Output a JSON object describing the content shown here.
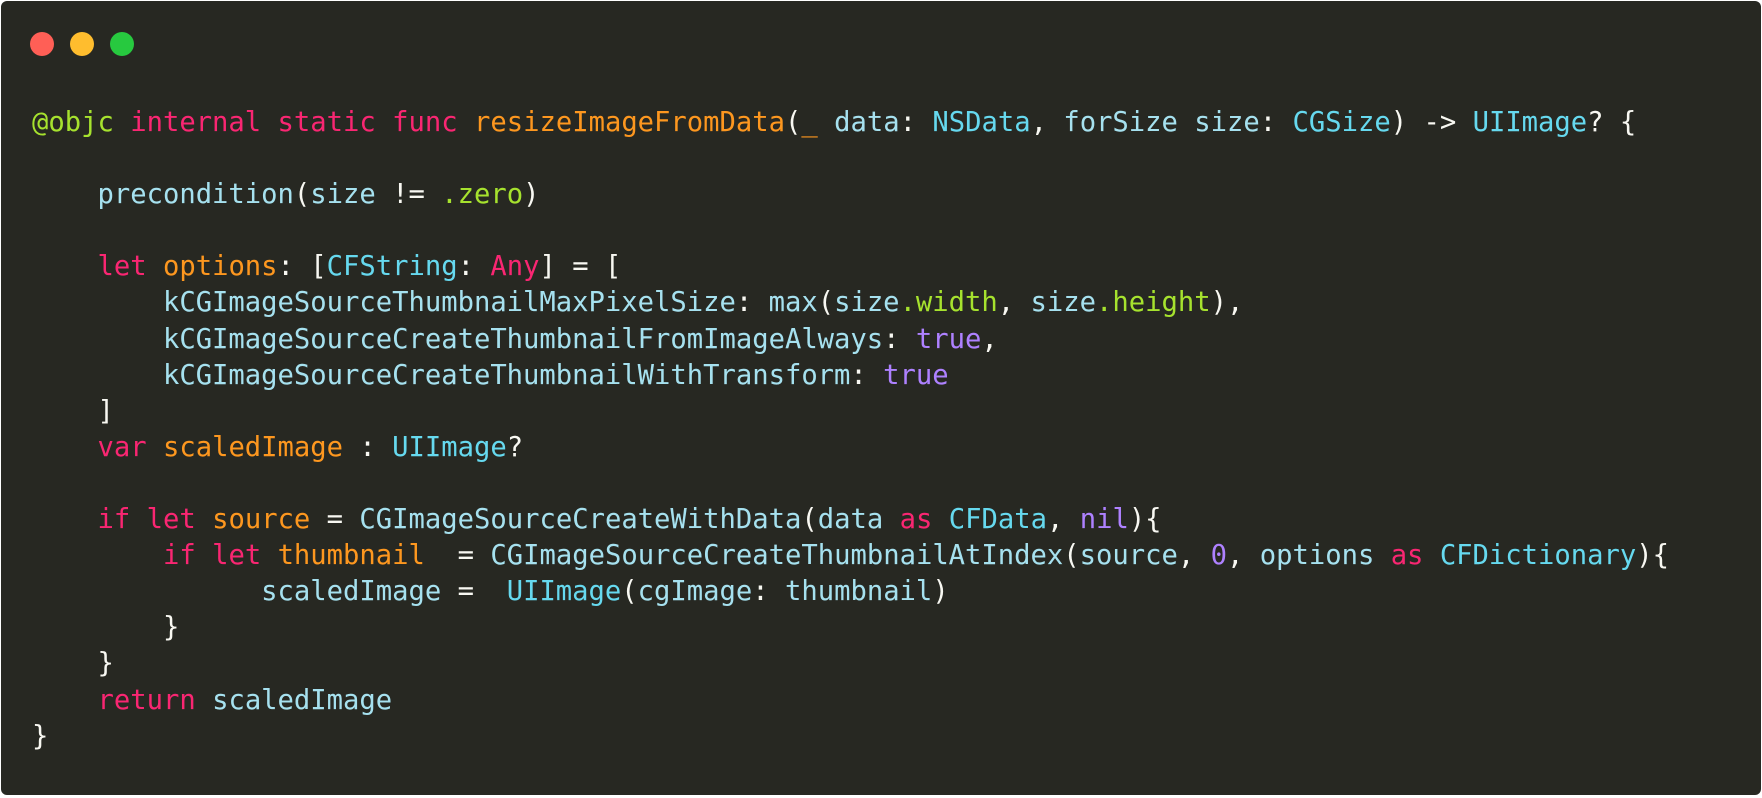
{
  "window": {
    "traffic_lights": [
      {
        "name": "close-button",
        "icon": "close-dot-icon",
        "color": "#ff5f56"
      },
      {
        "name": "minimize-button",
        "icon": "minimize-dot-icon",
        "color": "#ffbd2e"
      },
      {
        "name": "zoom-button",
        "icon": "zoom-dot-icon",
        "color": "#27c93f"
      }
    ]
  },
  "theme": {
    "background": "#272822",
    "plain": "#f8f8f2",
    "keyword": "#f92672",
    "type": "#66d9ef",
    "identifier": "#a6e1ef",
    "function": "#fd971f",
    "attribute": "#a6e22e",
    "literal": "#ae81ff"
  },
  "code": {
    "language": "swift",
    "lines": [
      [
        {
          "t": "@objc",
          "k": "attr"
        },
        {
          "t": " ",
          "k": "plain"
        },
        {
          "t": "internal",
          "k": "keyword"
        },
        {
          "t": " ",
          "k": "plain"
        },
        {
          "t": "static",
          "k": "keyword"
        },
        {
          "t": " ",
          "k": "plain"
        },
        {
          "t": "func",
          "k": "keyword"
        },
        {
          "t": " ",
          "k": "plain"
        },
        {
          "t": "resizeImageFromData",
          "k": "fn"
        },
        {
          "t": "(",
          "k": "plain"
        },
        {
          "t": "_",
          "k": "param"
        },
        {
          "t": " ",
          "k": "plain"
        },
        {
          "t": "data",
          "k": "ident"
        },
        {
          "t": ": ",
          "k": "plain"
        },
        {
          "t": "NSData",
          "k": "type"
        },
        {
          "t": ", ",
          "k": "plain"
        },
        {
          "t": "forSize",
          "k": "ident"
        },
        {
          "t": " ",
          "k": "plain"
        },
        {
          "t": "size",
          "k": "ident"
        },
        {
          "t": ": ",
          "k": "plain"
        },
        {
          "t": "CGSize",
          "k": "type"
        },
        {
          "t": ") -> ",
          "k": "plain"
        },
        {
          "t": "UIImage",
          "k": "type"
        },
        {
          "t": "? {",
          "k": "plain"
        }
      ],
      [],
      [
        {
          "t": "    ",
          "k": "plain"
        },
        {
          "t": "precondition",
          "k": "ident"
        },
        {
          "t": "(",
          "k": "plain"
        },
        {
          "t": "size",
          "k": "ident"
        },
        {
          "t": " != ",
          "k": "plain"
        },
        {
          "t": ".zero",
          "k": "prop"
        },
        {
          "t": ")",
          "k": "plain"
        }
      ],
      [],
      [
        {
          "t": "    ",
          "k": "plain"
        },
        {
          "t": "let",
          "k": "keyword"
        },
        {
          "t": " ",
          "k": "plain"
        },
        {
          "t": "options",
          "k": "fn"
        },
        {
          "t": ": [",
          "k": "plain"
        },
        {
          "t": "CFString",
          "k": "type"
        },
        {
          "t": ": ",
          "k": "plain"
        },
        {
          "t": "Any",
          "k": "keyword"
        },
        {
          "t": "] = [",
          "k": "plain"
        }
      ],
      [
        {
          "t": "        ",
          "k": "plain"
        },
        {
          "t": "kCGImageSourceThumbnailMaxPixelSize",
          "k": "ident"
        },
        {
          "t": ": ",
          "k": "plain"
        },
        {
          "t": "max",
          "k": "ident"
        },
        {
          "t": "(",
          "k": "plain"
        },
        {
          "t": "size",
          "k": "ident"
        },
        {
          "t": ".width",
          "k": "prop"
        },
        {
          "t": ", ",
          "k": "plain"
        },
        {
          "t": "size",
          "k": "ident"
        },
        {
          "t": ".height",
          "k": "prop"
        },
        {
          "t": "),",
          "k": "plain"
        }
      ],
      [
        {
          "t": "        ",
          "k": "plain"
        },
        {
          "t": "kCGImageSourceCreateThumbnailFromImageAlways",
          "k": "ident"
        },
        {
          "t": ": ",
          "k": "plain"
        },
        {
          "t": "true",
          "k": "literal"
        },
        {
          "t": ",",
          "k": "plain"
        }
      ],
      [
        {
          "t": "        ",
          "k": "plain"
        },
        {
          "t": "kCGImageSourceCreateThumbnailWithTransform",
          "k": "ident"
        },
        {
          "t": ": ",
          "k": "plain"
        },
        {
          "t": "true",
          "k": "literal"
        }
      ],
      [
        {
          "t": "    ]",
          "k": "plain"
        }
      ],
      [
        {
          "t": "    ",
          "k": "plain"
        },
        {
          "t": "var",
          "k": "keyword"
        },
        {
          "t": " ",
          "k": "plain"
        },
        {
          "t": "scaledImage",
          "k": "fn"
        },
        {
          "t": " : ",
          "k": "plain"
        },
        {
          "t": "UIImage",
          "k": "type"
        },
        {
          "t": "?",
          "k": "plain"
        }
      ],
      [],
      [
        {
          "t": "    ",
          "k": "plain"
        },
        {
          "t": "if",
          "k": "keyword"
        },
        {
          "t": " ",
          "k": "plain"
        },
        {
          "t": "let",
          "k": "keyword"
        },
        {
          "t": " ",
          "k": "plain"
        },
        {
          "t": "source",
          "k": "fn"
        },
        {
          "t": " = ",
          "k": "plain"
        },
        {
          "t": "CGImageSourceCreateWithData",
          "k": "ident"
        },
        {
          "t": "(",
          "k": "plain"
        },
        {
          "t": "data",
          "k": "ident"
        },
        {
          "t": " ",
          "k": "plain"
        },
        {
          "t": "as",
          "k": "keyword"
        },
        {
          "t": " ",
          "k": "plain"
        },
        {
          "t": "CFData",
          "k": "type"
        },
        {
          "t": ", ",
          "k": "plain"
        },
        {
          "t": "nil",
          "k": "literal"
        },
        {
          "t": "){",
          "k": "plain"
        }
      ],
      [
        {
          "t": "        ",
          "k": "plain"
        },
        {
          "t": "if",
          "k": "keyword"
        },
        {
          "t": " ",
          "k": "plain"
        },
        {
          "t": "let",
          "k": "keyword"
        },
        {
          "t": " ",
          "k": "plain"
        },
        {
          "t": "thumbnail",
          "k": "fn"
        },
        {
          "t": "  = ",
          "k": "plain"
        },
        {
          "t": "CGImageSourceCreateThumbnailAtIndex",
          "k": "ident"
        },
        {
          "t": "(",
          "k": "plain"
        },
        {
          "t": "source",
          "k": "ident"
        },
        {
          "t": ", ",
          "k": "plain"
        },
        {
          "t": "0",
          "k": "literal"
        },
        {
          "t": ", ",
          "k": "plain"
        },
        {
          "t": "options",
          "k": "ident"
        },
        {
          "t": " ",
          "k": "plain"
        },
        {
          "t": "as",
          "k": "keyword"
        },
        {
          "t": " ",
          "k": "plain"
        },
        {
          "t": "CFDictionary",
          "k": "type"
        },
        {
          "t": "){",
          "k": "plain"
        }
      ],
      [
        {
          "t": "              ",
          "k": "plain"
        },
        {
          "t": "scaledImage",
          "k": "ident"
        },
        {
          "t": " =  ",
          "k": "plain"
        },
        {
          "t": "UIImage",
          "k": "type"
        },
        {
          "t": "(",
          "k": "plain"
        },
        {
          "t": "cgImage",
          "k": "ident"
        },
        {
          "t": ": ",
          "k": "plain"
        },
        {
          "t": "thumbnail",
          "k": "ident"
        },
        {
          "t": ")",
          "k": "plain"
        }
      ],
      [
        {
          "t": "        }",
          "k": "plain"
        }
      ],
      [
        {
          "t": "    }",
          "k": "plain"
        }
      ],
      [
        {
          "t": "    ",
          "k": "plain"
        },
        {
          "t": "return",
          "k": "keyword"
        },
        {
          "t": " ",
          "k": "plain"
        },
        {
          "t": "scaledImage",
          "k": "ident"
        }
      ],
      [
        {
          "t": "}",
          "k": "plain"
        }
      ]
    ]
  }
}
